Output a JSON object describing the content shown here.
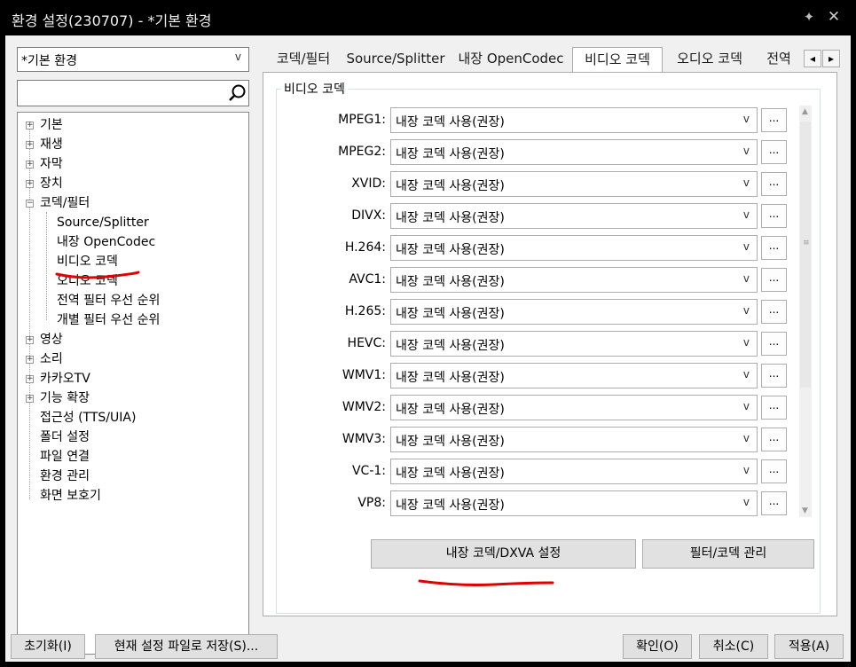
{
  "window": {
    "title": "환경 설정(230707) - *기본 환경",
    "pin_icon": "pin-icon",
    "close_icon": "close-icon"
  },
  "left": {
    "profile_select": "*기본 환경",
    "search_value": "",
    "tree": {
      "basic": "기본",
      "playback": "재생",
      "subtitle": "자막",
      "device": "장치",
      "codec_filter": "코덱/필터",
      "source_splitter": "Source/Splitter",
      "builtin_opencodec": "내장 OpenCodec",
      "video_codec": "비디오 코덱",
      "audio_codec": "오디오 코덱",
      "global_filter_priority": "전역 필터 우선 순위",
      "individual_filter_priority": "개별 필터 우선 순위",
      "video": "영상",
      "sound": "소리",
      "kakaotv": "카카오TV",
      "extensions": "기능 확장",
      "accessibility": "접근성 (TTS/UIA)",
      "folder_settings": "폴더 설정",
      "file_association": "파일 연결",
      "env_management": "환경 관리",
      "screensaver": "화면 보호기"
    }
  },
  "tabs": {
    "t1": "코덱/필터",
    "t2": "Source/Splitter",
    "t3": "내장 OpenCodec",
    "t4": "비디오 코덱",
    "t5": "오디오 코덱",
    "t6": "전역",
    "scroll_left": "◂",
    "scroll_right": "▸",
    "active": "비디오 코덱"
  },
  "group": {
    "label": "비디오 코덱",
    "rows": [
      {
        "label": "MPEG1:",
        "value": "내장 코덱 사용(권장)",
        "more": "..."
      },
      {
        "label": "MPEG2:",
        "value": "내장 코덱 사용(권장)",
        "more": "..."
      },
      {
        "label": "XVID:",
        "value": "내장 코덱 사용(권장)",
        "more": "..."
      },
      {
        "label": "DIVX:",
        "value": "내장 코덱 사용(권장)",
        "more": "..."
      },
      {
        "label": "H.264:",
        "value": "내장 코덱 사용(권장)",
        "more": "..."
      },
      {
        "label": "AVC1:",
        "value": "내장 코덱 사용(권장)",
        "more": "..."
      },
      {
        "label": "H.265:",
        "value": "내장 코덱 사용(권장)",
        "more": "..."
      },
      {
        "label": "HEVC:",
        "value": "내장 코덱 사용(권장)",
        "more": "..."
      },
      {
        "label": "WMV1:",
        "value": "내장 코덱 사용(권장)",
        "more": "..."
      },
      {
        "label": "WMV2:",
        "value": "내장 코덱 사용(권장)",
        "more": "..."
      },
      {
        "label": "WMV3:",
        "value": "내장 코덱 사용(권장)",
        "more": "..."
      },
      {
        "label": "VC-1:",
        "value": "내장 코덱 사용(권장)",
        "more": "..."
      },
      {
        "label": "VP8:",
        "value": "내장 코덱 사용(권장)",
        "more": "..."
      }
    ],
    "dropdown_arrow": "v"
  },
  "actions": {
    "dxva": "내장 코덱/DXVA 설정",
    "filter_manage": "필터/코덱 관리"
  },
  "footer": {
    "reset": "초기화(I)",
    "save_to_file": "현재 설정 파일로 저장(S)...",
    "ok": "확인(O)",
    "cancel": "취소(C)",
    "apply": "적용(A)"
  },
  "colors": {
    "titlebar": "#000000",
    "client": "#f0f0f0",
    "annotation": "#e00000"
  }
}
